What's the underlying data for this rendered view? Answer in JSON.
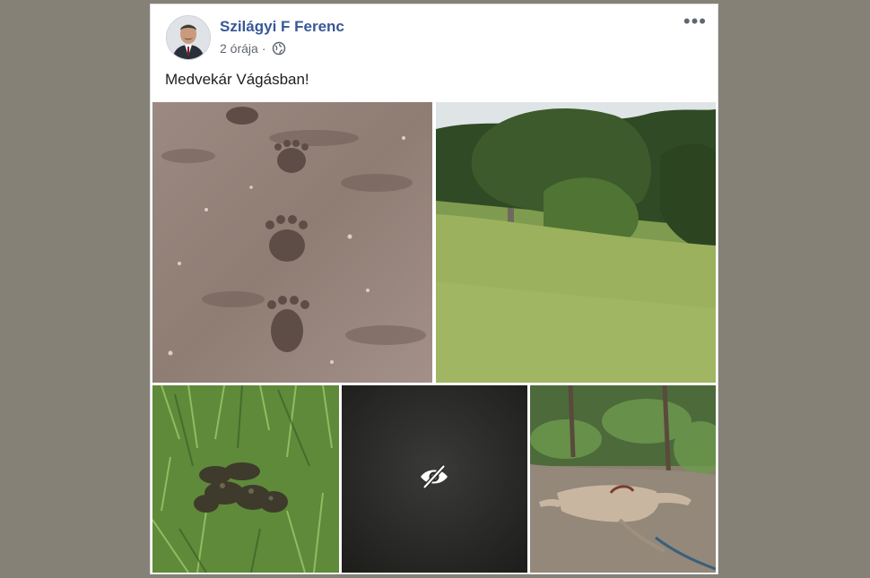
{
  "post": {
    "author": "Szilágyi F Ferenc",
    "time": "2 órája",
    "separator": "·",
    "privacy_icon": "globe-icon",
    "more_icon": "more-options-icon",
    "text": "Medvekár Vágásban!"
  },
  "photos": [
    {
      "subject": "bear-tracks"
    },
    {
      "subject": "meadow-trees"
    },
    {
      "subject": "bear-droppings"
    },
    {
      "subject": "hidden-sensitive-content",
      "icon": "eye-slash-icon"
    },
    {
      "subject": "animal-carcass"
    }
  ],
  "colors": {
    "background": "#858177",
    "author_link": "#385898",
    "meta_text": "#616770"
  }
}
